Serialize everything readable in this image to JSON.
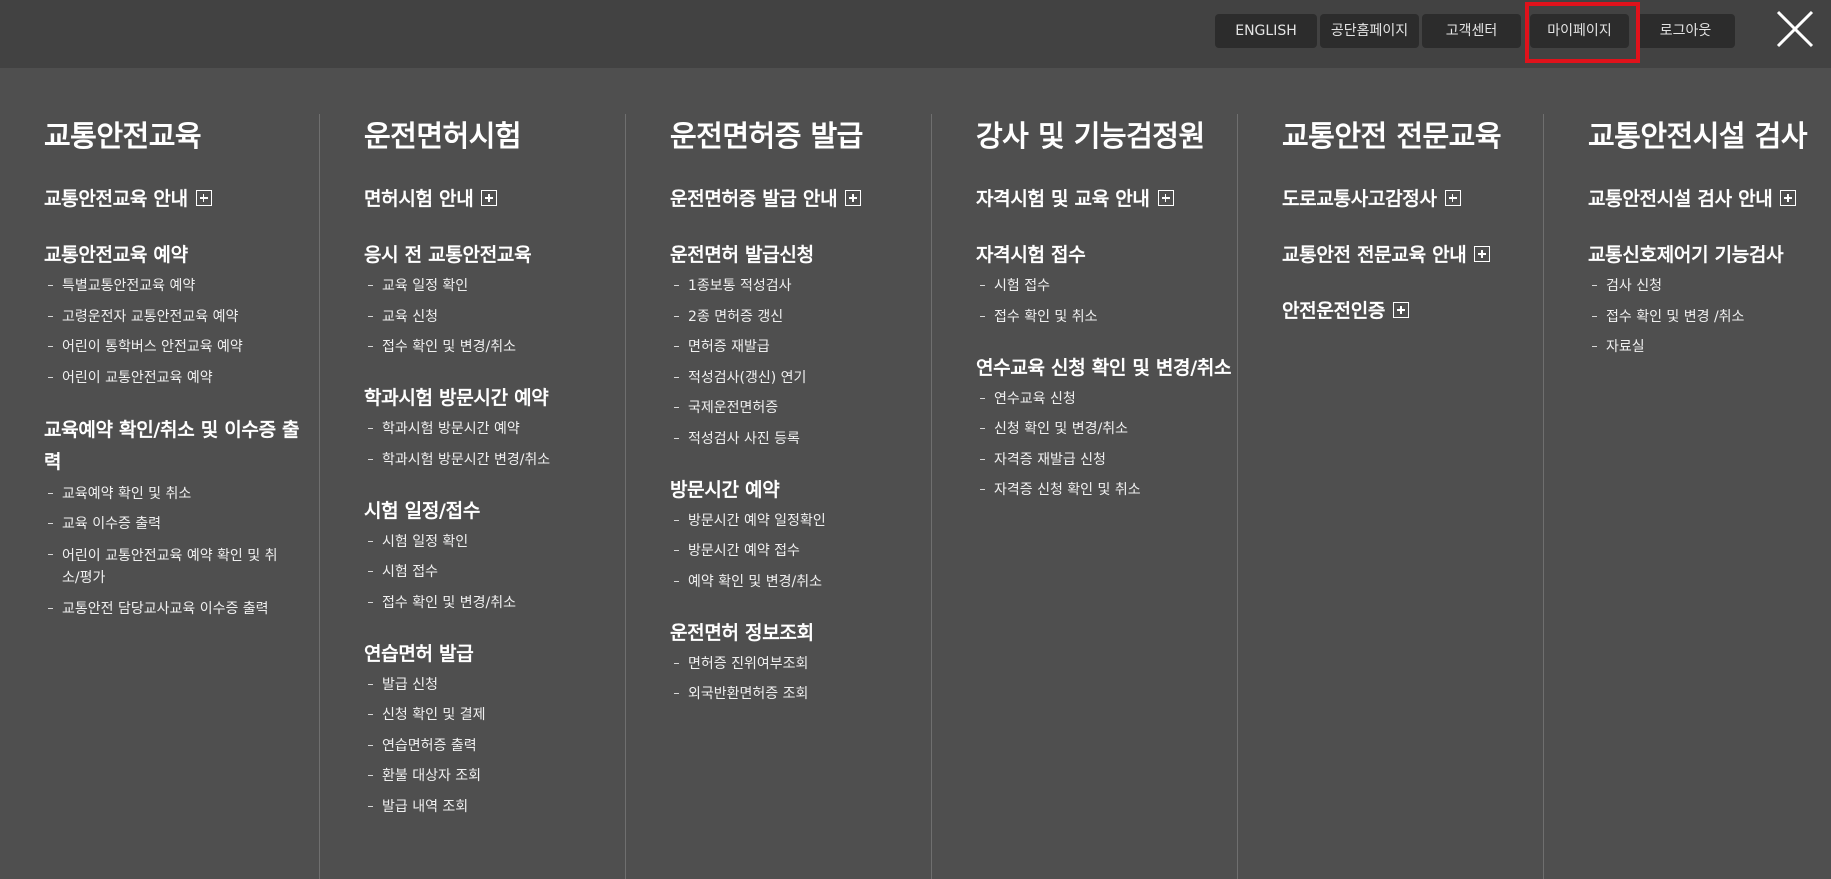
{
  "topbar": {
    "buttons": [
      "ENGLISH",
      "공단홈페이지",
      "고객센터",
      "마이페이지",
      "로그아웃"
    ],
    "highlighted": "마이페이지",
    "close_icon": "close-icon"
  },
  "columns": [
    {
      "title": "교통안전교육",
      "groups": [
        {
          "label": "교통안전교육 안내",
          "expandable": true,
          "items": []
        },
        {
          "label": "교통안전교육 예약",
          "items": [
            "특별교통안전교육 예약",
            "고령운전자 교통안전교육 예약",
            "어린이 통학버스 안전교육 예약",
            "어린이 교통안전교육 예약"
          ]
        },
        {
          "label": "교육예약 확인/취소 및 이수증 출력",
          "items": [
            "교육예약 확인 및 취소",
            "교육 이수증 출력",
            "어린이 교통안전교육 예약 확인 및 취소/평가",
            "교통안전 담당교사교육 이수증 출력"
          ]
        }
      ]
    },
    {
      "title": "운전면허시험",
      "groups": [
        {
          "label": "면허시험 안내",
          "expandable": true,
          "items": []
        },
        {
          "label": "응시 전 교통안전교육",
          "items": [
            "교육 일정 확인",
            "교육 신청",
            "접수 확인 및 변경/취소"
          ]
        },
        {
          "label": "학과시험 방문시간 예약",
          "items": [
            "학과시험 방문시간 예약",
            "학과시험 방문시간 변경/취소"
          ]
        },
        {
          "label": "시험 일정/접수",
          "items": [
            "시험 일정 확인",
            "시험 접수",
            "접수 확인 및 변경/취소"
          ]
        },
        {
          "label": "연습면허 발급",
          "items": [
            "발급 신청",
            "신청 확인 및 결제",
            "연습면허증 출력",
            "환불 대상자 조회",
            "발급 내역 조회"
          ]
        }
      ]
    },
    {
      "title": "운전면허증 발급",
      "groups": [
        {
          "label": "운전면허증 발급 안내",
          "expandable": true,
          "items": []
        },
        {
          "label": "운전면허 발급신청",
          "items": [
            "1종보통 적성검사",
            "2종 면허증 갱신",
            "면허증 재발급",
            "적성검사(갱신) 연기",
            "국제운전면허증",
            "적성검사 사진 등록"
          ]
        },
        {
          "label": "방문시간 예약",
          "items": [
            "방문시간 예약 일정확인",
            "방문시간 예약 접수",
            "예약 확인 및 변경/취소"
          ]
        },
        {
          "label": "운전면허 정보조회",
          "items": [
            "면허증 진위여부조회",
            "외국반환면허증 조회"
          ]
        }
      ]
    },
    {
      "title": "강사 및 기능검정원",
      "groups": [
        {
          "label": "자격시험 및 교육 안내",
          "expandable": true,
          "items": []
        },
        {
          "label": "자격시험 접수",
          "items": [
            "시험 접수",
            "접수 확인 및 취소"
          ]
        },
        {
          "label": "연수교육 신청 확인 및 변경/취소",
          "items": [
            "연수교육 신청",
            "신청 확인 및 변경/취소",
            "자격증 재발급 신청",
            "자격증 신청 확인 및 취소"
          ]
        }
      ]
    },
    {
      "title": "교통안전 전문교육",
      "groups": [
        {
          "label": "도로교통사고감정사",
          "expandable": true,
          "items": []
        },
        {
          "label": "교통안전 전문교육 안내",
          "expandable": true,
          "items": []
        },
        {
          "label": "안전운전인증",
          "expandable": true,
          "items": []
        }
      ]
    },
    {
      "title": "교통안전시설 검사",
      "groups": [
        {
          "label": "교통안전시설 검사 안내",
          "expandable": true,
          "items": []
        },
        {
          "label": "교통신호제어기 기능검사",
          "items": [
            "검사 신청",
            "접수 확인 및 변경 /취소",
            "자료실"
          ]
        }
      ]
    }
  ]
}
